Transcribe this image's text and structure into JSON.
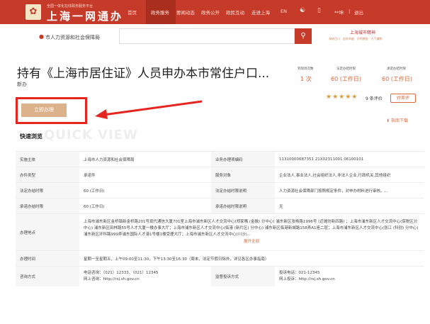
{
  "header": {
    "logo_small": "全国一体化在线政务服务平台",
    "logo_main": "上海一网通办",
    "nav": [
      "首页",
      "政务服务",
      "要闻动态",
      "政务公开",
      "政民互动",
      "走进上海",
      "EN"
    ],
    "user": "**坤",
    "logout": "退出",
    "divider": "|"
  },
  "search": {
    "location": "市人力资源和社会保障局",
    "placeholder": ""
  },
  "spirit": {
    "title": "上海城市精神",
    "subtitle": "海纳百川 · 追求卓越 · 开明睿智 · 大气谦和"
  },
  "page": {
    "title": "持有《上海市居住证》人员申办本市常住户口...",
    "subtitle": "新办"
  },
  "stats": [
    {
      "label": "到现场次数",
      "value": "1 次"
    },
    {
      "label": "法定办结时限",
      "value": "60 (工作日)"
    },
    {
      "label": "承诺办结时限",
      "value": "60 (工作日)"
    }
  ],
  "rating": {
    "stars": "★★★★★",
    "score": "9 条评价",
    "review_btn": "好差评"
  },
  "guide_download": "指南下载",
  "apply_btn": "立即办理",
  "quick_browse": {
    "title": "快速浏览",
    "watermark": "QUICK VIEW"
  },
  "table": {
    "row1": {
      "k1": "实施主体",
      "v1": "上海市人力资源和社会保障局",
      "k2": "业务办理项编码",
      "v2": "11310000687351 21X02311001 06100101"
    },
    "row2": {
      "k1": "办件类型",
      "v1": "承诺件",
      "k2": "服务对象",
      "v2": "企业法人,事业法人,社会组织法人,非法人企业,行政机关,其他组织"
    },
    "row3": {
      "k1": "法定办结时限",
      "v1": "60 (工作日)",
      "k2": "法定办结时限说明",
      "v2": "人力资源社会保障部门按照规定条件，对申办材料进行审核。..."
    },
    "row4": {
      "k1": "承诺办结时限",
      "v1": "60 (工作日)",
      "k2": "承诺办结时限说明",
      "v2": "无"
    },
    "row5": {
      "k1": "办理地点",
      "v1": "上海市浦东新区金桥镇新金桥路201号现代通信大厦701室上海市浦东新区人才交流中心(郑家嘴 (金融) 分中心) 浦东新区张杨路1996号 (近潍坊新四路) ；上海市浦东新区人才交流中心(保税区分中心) 浦东新区田林路55号人才大厦一楼办事大厅；上海市浦东新区人才交流中心(临港 (新片区) 分中心) 浦东新区临港新城路158弄A1座二层；上海市浦东新区人才交流中心(张江 (科创) 分中心) 浦东新区环科路999弄浦东国际人才港1号楼1楼受理大厅；上海市浦东新区人才交流中心(川沙)...",
      "expand": "展开全部"
    },
    "row6": {
      "k1": "办理时间",
      "v1": "星期一至星期五，上午09:00至11:30，下午13:30至16:30（周末、法定节假日除外，详见各区办事指南）"
    },
    "row7": {
      "k1": "咨询方式",
      "v1a": "电话咨询：（021）12333、（021）12345",
      "v1b": "网上咨询：http://rsj.sh.gov.cn",
      "k2": "监督投诉方式",
      "v2a": "投诉电话：021-12345",
      "v2b": "网上投诉：http://rsj.sh.gov.cn"
    }
  },
  "colors": {
    "brand_red": "#c53a28",
    "accent_orange": "#d96a3e",
    "apply_btn": "#dcb28a",
    "highlight_red": "#e52620"
  }
}
